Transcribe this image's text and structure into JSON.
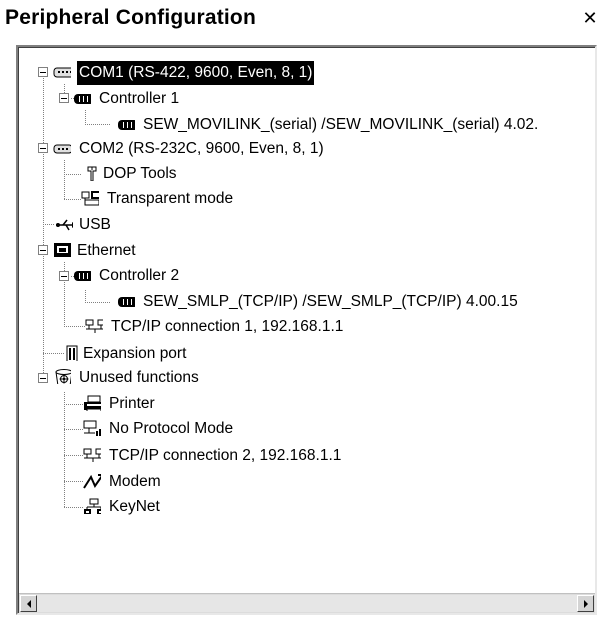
{
  "window": {
    "title": "Peripheral Configuration",
    "close_glyph": "✕"
  },
  "tree": {
    "com1": "COM1  (RS-422, 9600, Even, 8, 1)",
    "controller1": "Controller 1",
    "driver1": "SEW_MOVILINK_(serial) /SEW_MOVILINK_(serial)  4.02.",
    "com2": "COM2  (RS-232C, 9600, Even, 8, 1)",
    "dop_tools": "DOP Tools",
    "transparent": "Transparent mode",
    "usb": "USB",
    "ethernet": "Ethernet",
    "controller2": "Controller 2",
    "driver2": "SEW_SMLP_(TCP/IP) /SEW_SMLP_(TCP/IP)  4.00.15",
    "tcpip1": "TCP/IP connection 1, 192.168.1.1",
    "expansion": "Expansion port",
    "unused": "Unused functions",
    "printer": "Printer",
    "no_protocol": "No Protocol Mode",
    "tcpip2": "TCP/IP connection 2, 192.168.1.1",
    "modem": "Modem",
    "keynet": "KeyNet"
  },
  "icons": {
    "com1": "serial-port-icon",
    "controller": "controller-icon",
    "com2": "serial-port-icon",
    "dop_tools": "tool-icon",
    "transparent": "transparent-mode-icon",
    "usb": "usb-icon",
    "ethernet": "ethernet-icon",
    "tcpip": "network-icon",
    "expansion": "expansion-port-icon",
    "unused": "unused-functions-icon",
    "printer": "printer-icon",
    "no_protocol": "no-protocol-icon",
    "modem": "modem-icon",
    "keynet": "keynet-icon"
  },
  "colors": {
    "selection_bg": "#000000",
    "selection_fg": "#ffffff"
  }
}
